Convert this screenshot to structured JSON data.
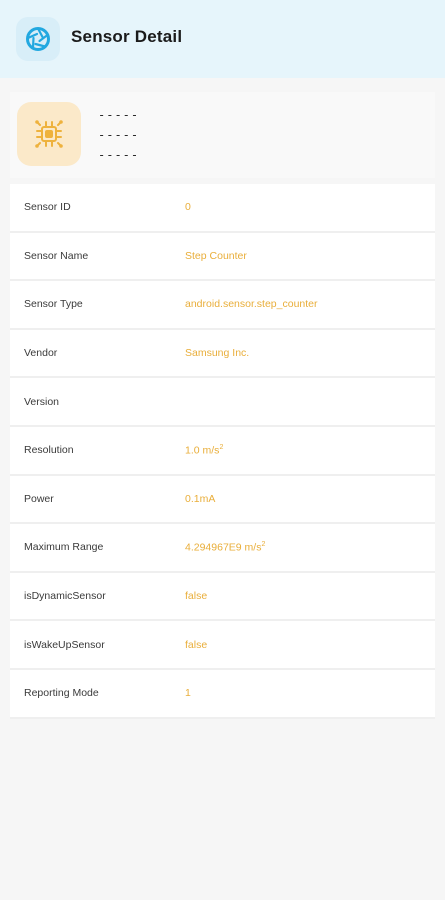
{
  "app_bar": {
    "title": "Sensor Detail",
    "logo_icon": "aperture-icon"
  },
  "header": {
    "sensor_icon": "chip-icon",
    "placeholders": [
      "-----",
      "-----",
      "-----"
    ]
  },
  "colors": {
    "app_bar_bg": "#e6f5fb",
    "value_text": "#e9ae3a",
    "logo_accent": "#22a8e0",
    "icon_tile": "#fbe9c9"
  },
  "details": [
    {
      "label": "Sensor ID",
      "value": "0"
    },
    {
      "label": "Sensor Name",
      "value": "Step Counter"
    },
    {
      "label": "Sensor Type",
      "value": "android.sensor.step_counter"
    },
    {
      "label": "Vendor",
      "value": "Samsung Inc."
    },
    {
      "label": "Version",
      "value": ""
    },
    {
      "label": "Resolution",
      "value": "1.0 m/s",
      "sup": "2"
    },
    {
      "label": "Power",
      "value": "0.1mA"
    },
    {
      "label": "Maximum Range",
      "value": "4.294967E9 m/s",
      "sup": "2"
    },
    {
      "label": "isDynamicSensor",
      "value": "false"
    },
    {
      "label": "isWakeUpSensor",
      "value": "false"
    },
    {
      "label": "Reporting Mode",
      "value": "1"
    }
  ]
}
